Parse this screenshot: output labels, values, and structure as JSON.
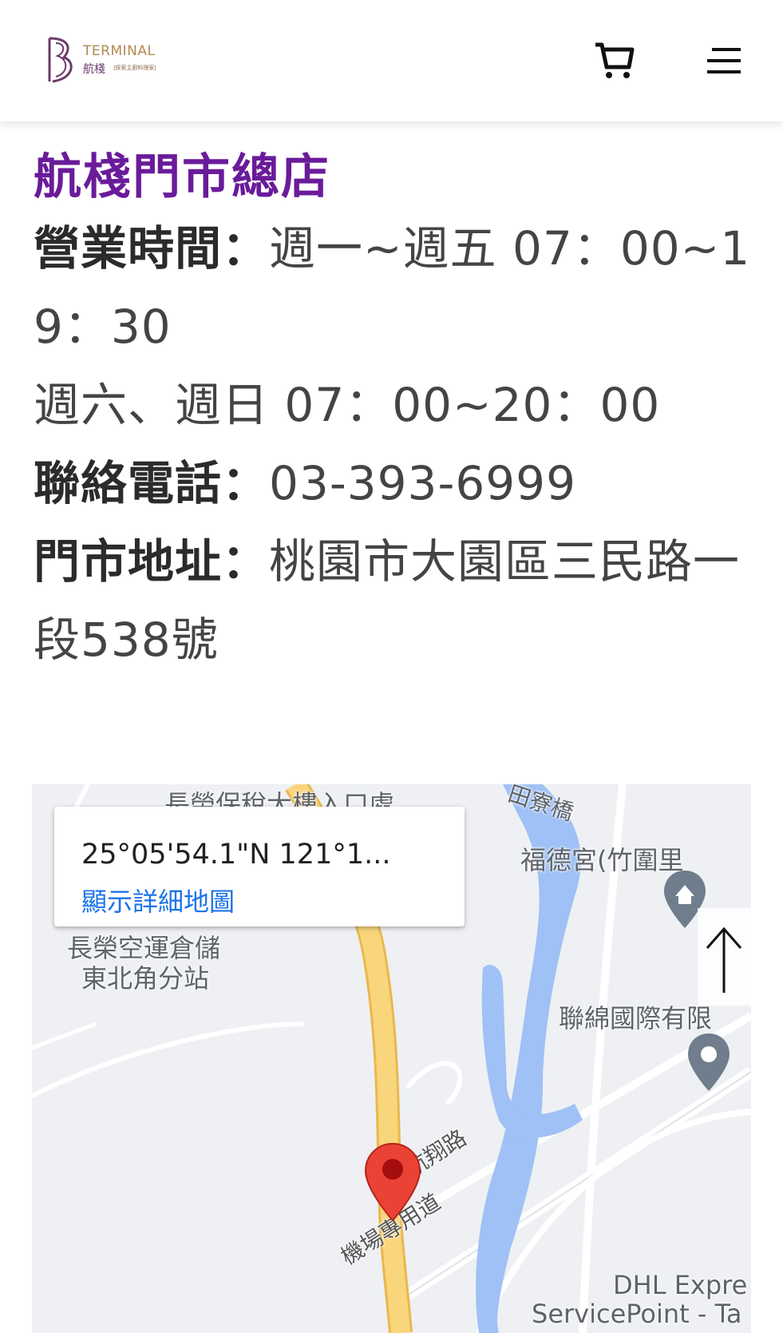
{
  "header": {
    "logo": {
      "brand_en": "TERMINAL",
      "brand_zh": "航棧",
      "brand_tag": "|探索主廚料理家|"
    },
    "cart_icon": "cart-icon",
    "menu_icon": "hamburger-menu-icon"
  },
  "store": {
    "title": "航棧門市總店",
    "hours_label": "營業時間：",
    "hours_weekday": "週一~週五 07：00~19：30",
    "hours_weekend": "週六、週日 07：00~20：00",
    "phone_label": "聯絡電話：",
    "phone": "03-393-6999",
    "address_label": "門市地址：",
    "address": "桃園市大園區三民路一段538號"
  },
  "map": {
    "coords": "25°05'54.1\"N 121°1...",
    "detail_link": "顯示詳細地圖",
    "labels": {
      "top_cut": "長榮保稅大樓入口處",
      "bridge": "田寮橋",
      "temple": "福德宮(竹圍里",
      "warehouse_1": "長榮空運倉儲",
      "warehouse_2": "東北角分站",
      "company": "聯綿國際有限",
      "road_1": "航翔路",
      "road_2": "機場專用道",
      "dhl_1": "DHL Expre",
      "dhl_2": "ServicePoint - Ta"
    }
  },
  "colors": {
    "title_purple": "#6a1b9a",
    "river_blue": "#9fc1f5",
    "road_yellow": "#f9d57c",
    "marker_red": "#ea4335",
    "link_blue": "#1a73e8"
  }
}
